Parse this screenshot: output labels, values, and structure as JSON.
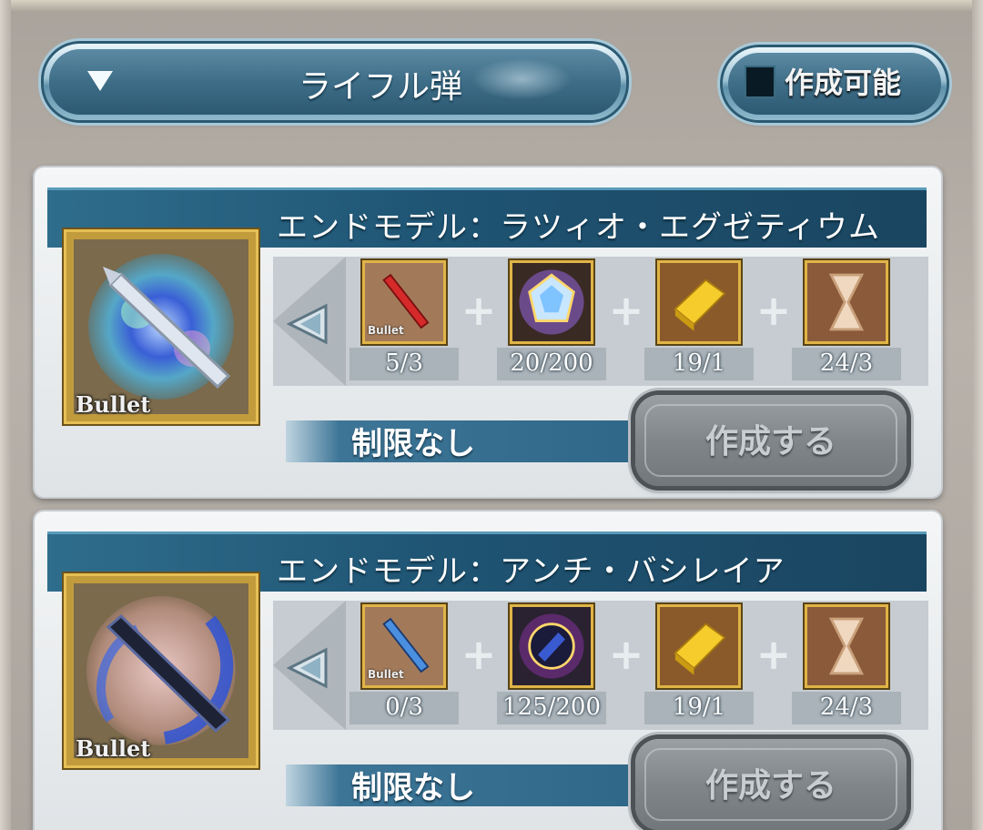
{
  "filter": {
    "category_label": "ライフル弾",
    "craftable_only_label": "作成可能",
    "craftable_only_checked": false
  },
  "recipes": [
    {
      "title": "エンドモデル：ラツィオ・エグゼティウム",
      "item_tag": "Bullet",
      "ingredients": [
        {
          "icon": "red-bullet-icon",
          "tag": "Bullet",
          "count": "5/3"
        },
        {
          "icon": "prism-crystal-icon",
          "count": "20/200"
        },
        {
          "icon": "gold-bar-icon",
          "count": "19/1"
        },
        {
          "icon": "hourglass-icon",
          "count": "24/3"
        }
      ],
      "limit_label": "制限なし",
      "craft_label": "作成する"
    },
    {
      "title": "エンドモデル：アンチ・バシレイア",
      "item_tag": "Bullet",
      "ingredients": [
        {
          "icon": "blue-bullet-icon",
          "tag": "Bullet",
          "count": "0/3"
        },
        {
          "icon": "dark-orb-icon",
          "count": "125/200"
        },
        {
          "icon": "gold-bar-icon",
          "count": "19/1"
        },
        {
          "icon": "hourglass-icon",
          "count": "24/3"
        }
      ],
      "limit_label": "制限なし",
      "craft_label": "作成する"
    }
  ],
  "colors": {
    "header_blue": "#1f5473",
    "portrait_gold": "#e6bf55",
    "craft_button_gray": "#80868a"
  }
}
